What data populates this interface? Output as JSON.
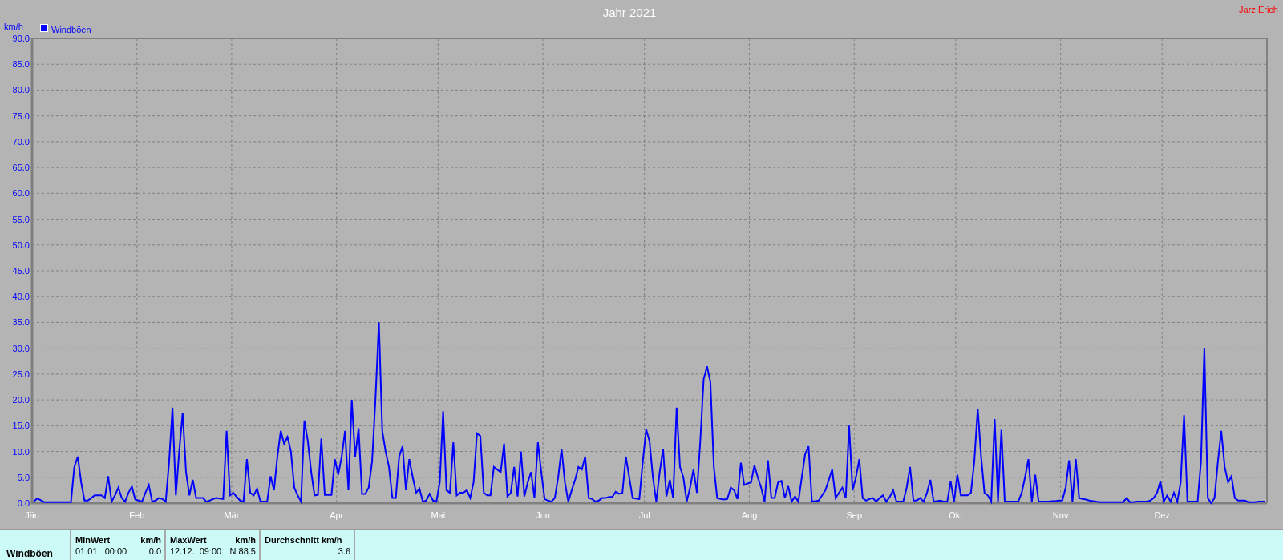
{
  "title": "Jahr 2021",
  "author": "Jarz Erich",
  "chart": {
    "chart_data": {
      "type": "line",
      "grid": true,
      "ylabel": "km/h",
      "ylim": [
        0,
        90
      ],
      "yticks": [
        {
          "value": 0,
          "label": "0.0"
        },
        {
          "value": 5,
          "label": "5.0"
        },
        {
          "value": 10,
          "label": "10.0"
        },
        {
          "value": 15,
          "label": "15.0"
        },
        {
          "value": 20,
          "label": "20.0"
        },
        {
          "value": 25,
          "label": "25.0"
        },
        {
          "value": 30,
          "label": "30.0"
        },
        {
          "value": 35,
          "label": "35.0"
        },
        {
          "value": 40,
          "label": "40.0"
        },
        {
          "value": 45,
          "label": "45.0"
        },
        {
          "value": 50,
          "label": "50.0"
        },
        {
          "value": 55,
          "label": "55.0"
        },
        {
          "value": 60,
          "label": "60.0"
        },
        {
          "value": 65,
          "label": "65.0"
        },
        {
          "value": 70,
          "label": "70.0"
        },
        {
          "value": 75,
          "label": "75.0"
        },
        {
          "value": 80,
          "label": "80.0"
        },
        {
          "value": 85,
          "label": "85.0"
        },
        {
          "value": 90,
          "label": "90.0"
        }
      ],
      "categories": [
        "Jän",
        null,
        null,
        null,
        null,
        null,
        null,
        null,
        null,
        null,
        null,
        null,
        null,
        null,
        null,
        null,
        null,
        null,
        null,
        null,
        null,
        null,
        null,
        null,
        null,
        null,
        null,
        null,
        null,
        null,
        null,
        "Feb",
        null,
        null,
        null,
        null,
        null,
        null,
        null,
        null,
        null,
        null,
        null,
        null,
        null,
        null,
        null,
        null,
        null,
        null,
        null,
        null,
        null,
        null,
        null,
        null,
        null,
        null,
        null,
        "Mär",
        null,
        null,
        null,
        null,
        null,
        null,
        null,
        null,
        null,
        null,
        null,
        null,
        null,
        null,
        null,
        null,
        null,
        null,
        null,
        null,
        null,
        null,
        null,
        null,
        null,
        null,
        null,
        null,
        null,
        null,
        "Apr",
        null,
        null,
        null,
        null,
        null,
        null,
        null,
        null,
        null,
        null,
        null,
        null,
        null,
        null,
        null,
        null,
        null,
        null,
        null,
        null,
        null,
        null,
        null,
        null,
        null,
        null,
        null,
        null,
        null,
        "Mai",
        null,
        null,
        null,
        null,
        null,
        null,
        null,
        null,
        null,
        null,
        null,
        null,
        null,
        null,
        null,
        null,
        null,
        null,
        null,
        null,
        null,
        null,
        null,
        null,
        null,
        null,
        null,
        null,
        null,
        null,
        "Jun",
        null,
        null,
        null,
        null,
        null,
        null,
        null,
        null,
        null,
        null,
        null,
        null,
        null,
        null,
        null,
        null,
        null,
        null,
        null,
        null,
        null,
        null,
        null,
        null,
        null,
        null,
        null,
        null,
        null,
        "Jul",
        null,
        null,
        null,
        null,
        null,
        null,
        null,
        null,
        null,
        null,
        null,
        null,
        null,
        null,
        null,
        null,
        null,
        null,
        null,
        null,
        null,
        null,
        null,
        null,
        null,
        null,
        null,
        null,
        null,
        null,
        "Aug",
        null,
        null,
        null,
        null,
        null,
        null,
        null,
        null,
        null,
        null,
        null,
        null,
        null,
        null,
        null,
        null,
        null,
        null,
        null,
        null,
        null,
        null,
        null,
        null,
        null,
        null,
        null,
        null,
        null,
        null,
        "Sep",
        null,
        null,
        null,
        null,
        null,
        null,
        null,
        null,
        null,
        null,
        null,
        null,
        null,
        null,
        null,
        null,
        null,
        null,
        null,
        null,
        null,
        null,
        null,
        null,
        null,
        null,
        null,
        null,
        null,
        "Okt",
        null,
        null,
        null,
        null,
        null,
        null,
        null,
        null,
        null,
        null,
        null,
        null,
        null,
        null,
        null,
        null,
        null,
        null,
        null,
        null,
        null,
        null,
        null,
        null,
        null,
        null,
        null,
        null,
        null,
        null,
        "Nov",
        null,
        null,
        null,
        null,
        null,
        null,
        null,
        null,
        null,
        null,
        null,
        null,
        null,
        null,
        null,
        null,
        null,
        null,
        null,
        null,
        null,
        null,
        null,
        null,
        null,
        null,
        null,
        null,
        null,
        "Dez",
        null,
        null,
        null,
        null,
        null,
        null,
        null,
        null,
        null,
        null,
        null,
        null,
        null,
        null,
        null,
        null,
        null,
        null,
        null,
        null,
        null,
        null,
        null,
        null,
        null,
        null,
        null,
        null,
        null,
        null
      ],
      "series": [
        {
          "name": "Windböen",
          "color": "#0000ff",
          "values": [
            0.3,
            0.9,
            0.6,
            0.2,
            0.2,
            0.2,
            0.2,
            0.2,
            0.2,
            0.2,
            0.2,
            0.2,
            7,
            9,
            4,
            0.5,
            0.5,
            1,
            1.5,
            1.5,
            1.5,
            1,
            5.2,
            0.3,
            1.5,
            3,
            1,
            0.3,
            2,
            3.2,
            0.7,
            0.5,
            0.3,
            2,
            3.5,
            0.3,
            0.5,
            1,
            0.8,
            0.3,
            8,
            18.5,
            1.5,
            10,
            17.5,
            6,
            1.5,
            4.5,
            1,
            1,
            1,
            0.3,
            0.5,
            0.8,
            1,
            0.9,
            0.8,
            14,
            1.5,
            2,
            1.2,
            0.5,
            0.3,
            8.5,
            2,
            1.5,
            2.8,
            0.3,
            0.3,
            0.3,
            5.2,
            2.5,
            9,
            14,
            11.5,
            12.8,
            10,
            3,
            1.5,
            0.3,
            16,
            12,
            6,
            1.5,
            1.6,
            12.5,
            1.6,
            1.6,
            1.6,
            8.5,
            5.5,
            9,
            14,
            2.5,
            20,
            9,
            14.5,
            1.8,
            1.8,
            3,
            8,
            20,
            35,
            14,
            10,
            7,
            1,
            1,
            9,
            11,
            2.5,
            8.5,
            5,
            2,
            2.8,
            0.3,
            0.5,
            1.8,
            0.5,
            0.3,
            4,
            17.8,
            2.5,
            2,
            11.8,
            1.5,
            2,
            2,
            2.5,
            1,
            4,
            13.5,
            13,
            2,
            1.5,
            1.5,
            7,
            6.5,
            6,
            11.5,
            1.3,
            2,
            7,
            1.3,
            10,
            1.3,
            4,
            6,
            1,
            11.8,
            6,
            0.8,
            0.5,
            0.3,
            1,
            5,
            10.5,
            4,
            0.3,
            2.5,
            4.5,
            7,
            6.5,
            9,
            1,
            0.8,
            0.3,
            0.5,
            1,
            1,
            1.2,
            1.2,
            2.2,
            1.8,
            2,
            9,
            5,
            1,
            0.9,
            0.8,
            8,
            14.3,
            12,
            5,
            0.3,
            6,
            10.5,
            1.3,
            4.5,
            1,
            18.5,
            7,
            5,
            0.3,
            3,
            6.5,
            2,
            12,
            24,
            26.5,
            23.5,
            7,
            1,
            0.8,
            0.7,
            0.8,
            3,
            2.5,
            0.8,
            7.8,
            3.5,
            3.8,
            4,
            7.3,
            5,
            3,
            0.3,
            8.3,
            1,
            1,
            4,
            4.3,
            1,
            3.3,
            0.3,
            1.3,
            0.3,
            5,
            9.5,
            11,
            0.3,
            0.4,
            0.5,
            1.5,
            2.5,
            4.5,
            6.5,
            1,
            2,
            3,
            1,
            15,
            2.5,
            5,
            8.5,
            1,
            0.5,
            0.8,
            1,
            0.3,
            1,
            1.5,
            0.3,
            1.2,
            2.5,
            0.3,
            0.3,
            0.3,
            3,
            7,
            0.5,
            0.5,
            1,
            0.3,
            2,
            4.5,
            0.3,
            0.4,
            0.5,
            0.3,
            0.3,
            4.2,
            0.3,
            5.5,
            1.5,
            1.5,
            1.5,
            2,
            8,
            18.3,
            9,
            2,
            1.5,
            0.3,
            16.3,
            0.3,
            14.2,
            0.3,
            0.3,
            0.3,
            0.3,
            0.3,
            2,
            5,
            8.5,
            0.3,
            5.5,
            0.3,
            0.3,
            0.3,
            0.3,
            0.4,
            0.4,
            0.5,
            0.5,
            3,
            8.3,
            0.3,
            8.5,
            1,
            0.8,
            0.7,
            0.5,
            0.4,
            0.3,
            0.2,
            0.2,
            0.2,
            0.2,
            0.2,
            0.2,
            0.2,
            0.2,
            1,
            0.2,
            0.2,
            0.3,
            0.3,
            0.3,
            0.3,
            0.5,
            1,
            2,
            4.2,
            0.3,
            1.5,
            0.3,
            2,
            0.3,
            4,
            17,
            0.3,
            0.3,
            0.3,
            0.3,
            8,
            30,
            1,
            0,
            1,
            8,
            14,
            7,
            4,
            5.2,
            1,
            0.5,
            0.5,
            0.5,
            0.2,
            0.2,
            0.2,
            0.3,
            0.3,
            0.3
          ]
        }
      ]
    }
  },
  "summary": {
    "label": "Windböen",
    "columns": [
      {
        "header": "MinWert",
        "unit": "km/h",
        "date": "01.01.  00:00",
        "value": "0.0"
      },
      {
        "header": "MaxWert",
        "unit": "km/h",
        "date": "12.12.  09:00",
        "value": "N 88.5"
      },
      {
        "header": "Durchschnitt km/h",
        "value": "3.6"
      }
    ]
  }
}
